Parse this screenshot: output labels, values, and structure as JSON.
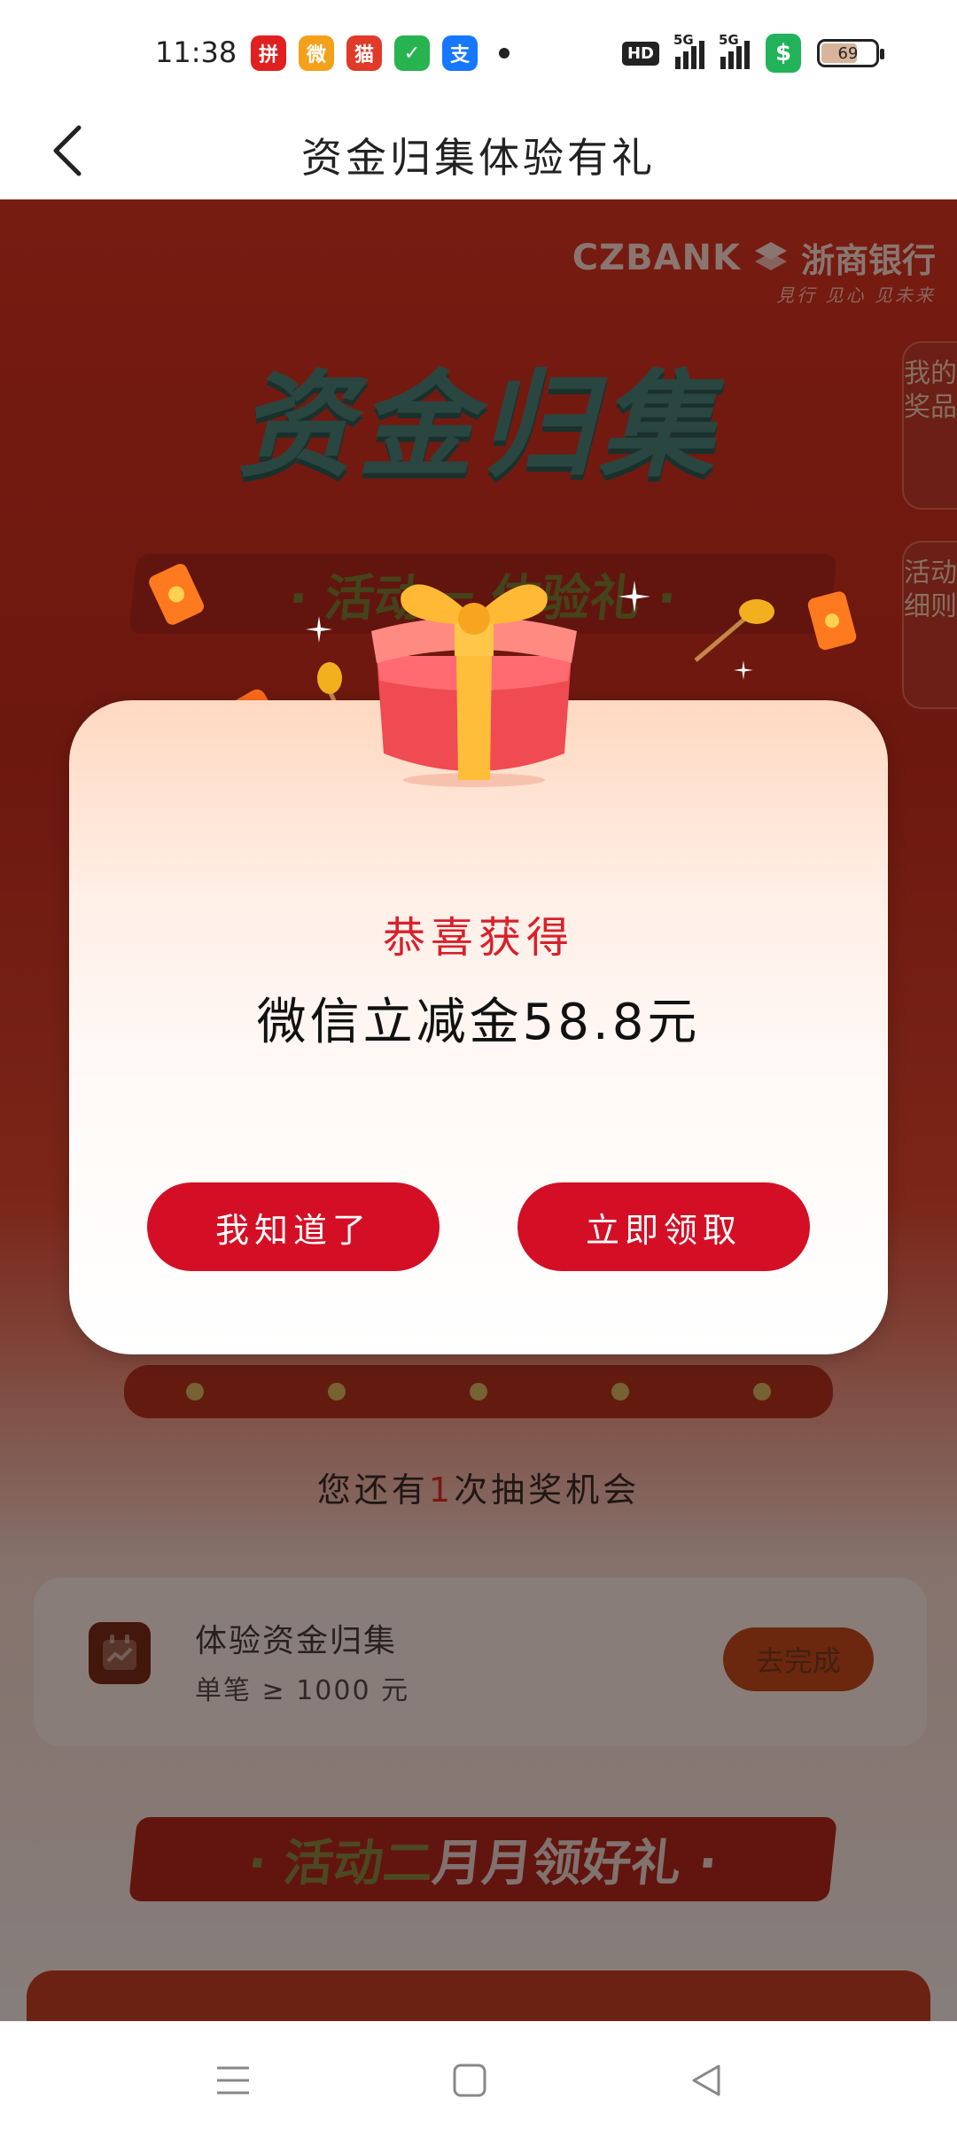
{
  "status_bar": {
    "time": "11:38",
    "app_icons": [
      {
        "name": "pinduoduo-app-icon",
        "glyph": "拼",
        "color": "#e02020"
      },
      {
        "name": "weibo-app-icon",
        "glyph": "微",
        "color": "#f3a11b"
      },
      {
        "name": "tmall-app-icon",
        "glyph": "猫",
        "color": "#e03a2a"
      },
      {
        "name": "wechat-mini-icon",
        "glyph": "✓",
        "color": "#27b34f"
      },
      {
        "name": "alipay-app-icon",
        "glyph": "支",
        "color": "#1677ff"
      }
    ],
    "hd_label": "HD",
    "signal1_label": "5G",
    "signal2_label": "5G",
    "battery_level": "69"
  },
  "header": {
    "title": "资金归集体验有礼"
  },
  "background": {
    "bank_name_en": "CZBANK",
    "bank_name_cn": "浙商银行",
    "bank_slogan": "見行 见心 见未来",
    "hero_title": "资金归集",
    "side_tab_prizes": "我的奖品",
    "side_tab_rules": "活动细则",
    "banner1_text": "· 活动一 体验礼 ·",
    "chance_prefix": "您还有",
    "chance_count": "1",
    "chance_suffix": "次抽奖机会",
    "task_title": "体验资金归集",
    "task_subtitle": "单笔 ≥ 1000 元",
    "task_button": "去完成",
    "banner2_prefix": "· 活动二",
    "banner2_suffix": " 月月领好礼 ·"
  },
  "dialog": {
    "congrats_text": "恭喜获得",
    "prize_text": "微信立减金58.8元",
    "ok_button": "我知道了",
    "claim_button": "立即领取"
  }
}
